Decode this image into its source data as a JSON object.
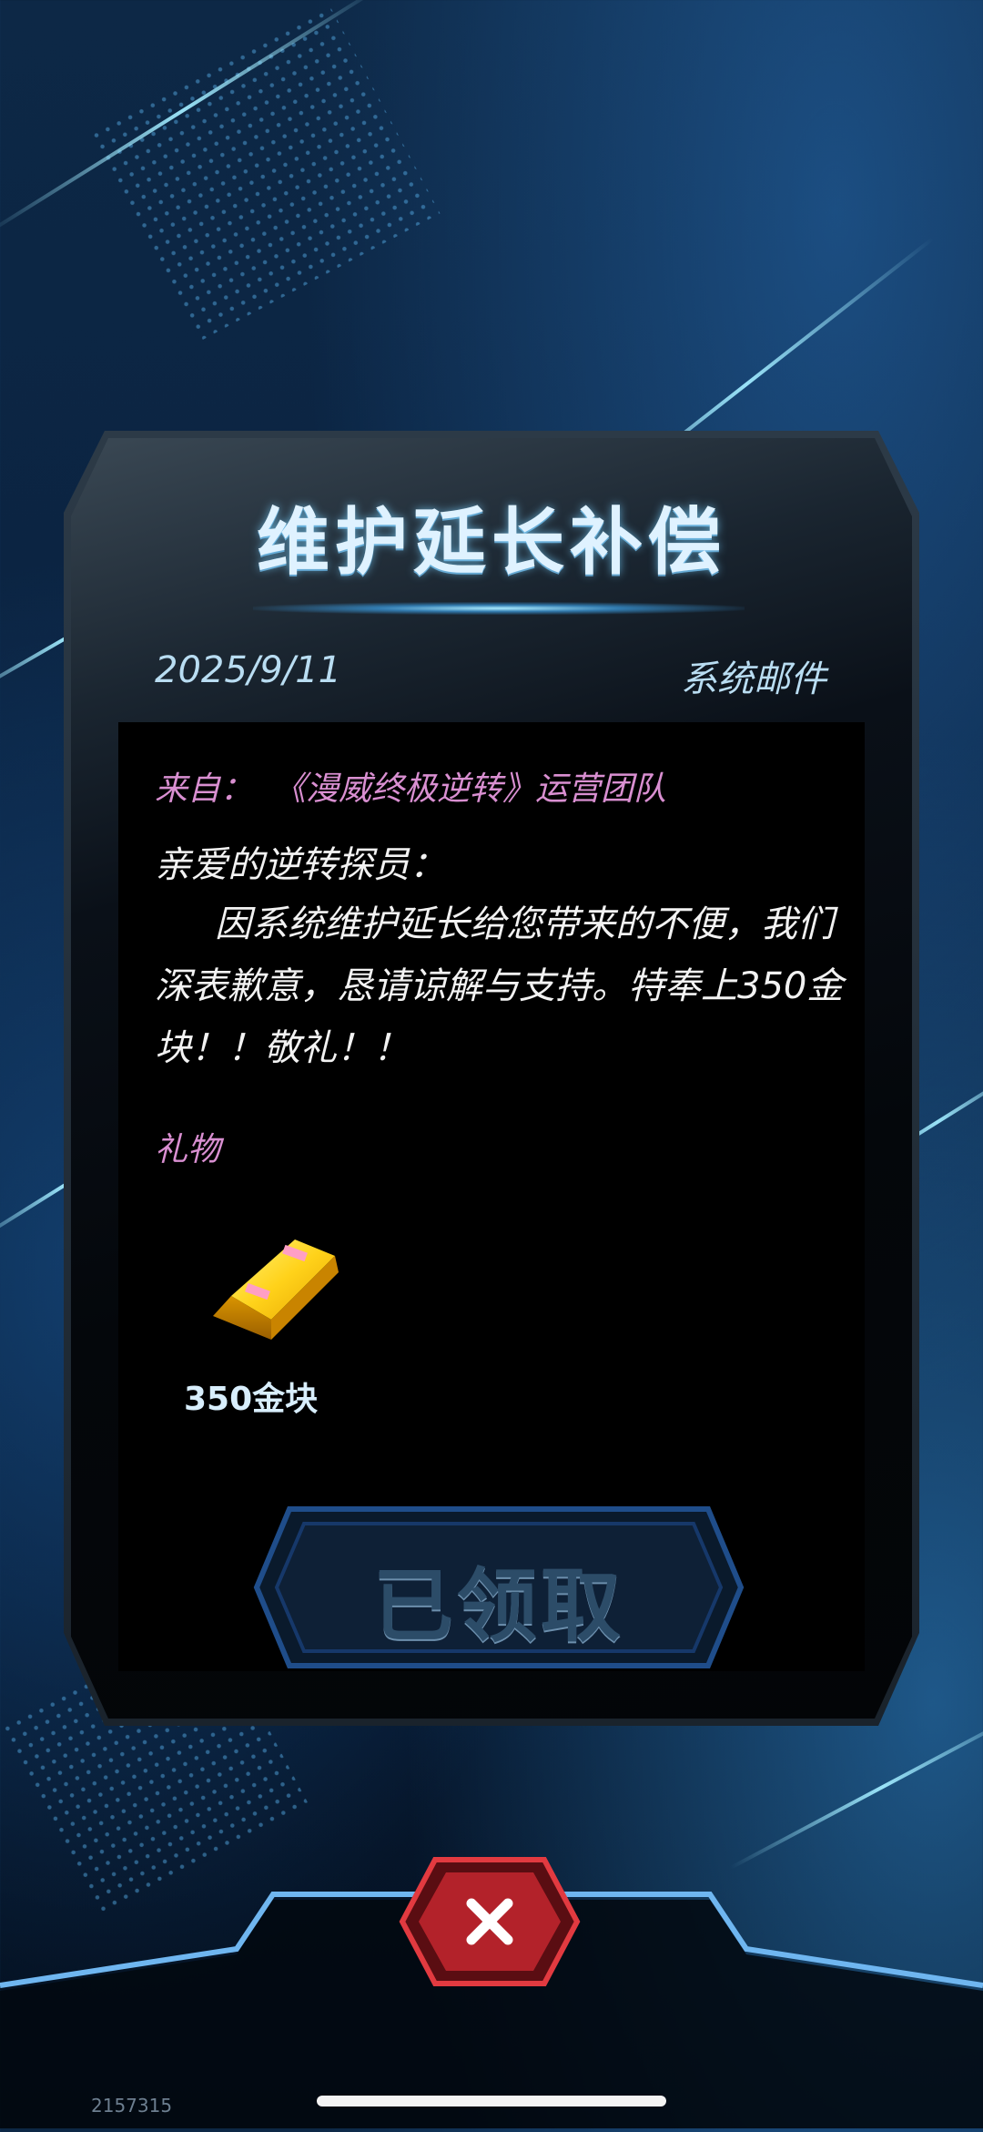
{
  "mail": {
    "title": "维护延长补偿",
    "date": "2025/9/11",
    "type": "系统邮件",
    "from_label": "来自：",
    "from_value": "《漫威终极逆转》运营团队",
    "greeting": "亲爱的逆转探员：",
    "body": "因系统维护延长给您带来的不便，我们深表歉意，恳请谅解与支持。特奉上350金块！！敬礼！！",
    "gift_label": "礼物",
    "gift": {
      "name": "350金块",
      "icon": "gold-bar-icon"
    },
    "claim_button": "已领取"
  },
  "close_icon": "close-icon",
  "build_id": "2157315",
  "colors": {
    "title": "#dff2ff",
    "meta": "#b9ddf2",
    "accent_pink": "#d98fd1",
    "body_text": "#f2f2f2",
    "close_red": "#c4262b"
  }
}
